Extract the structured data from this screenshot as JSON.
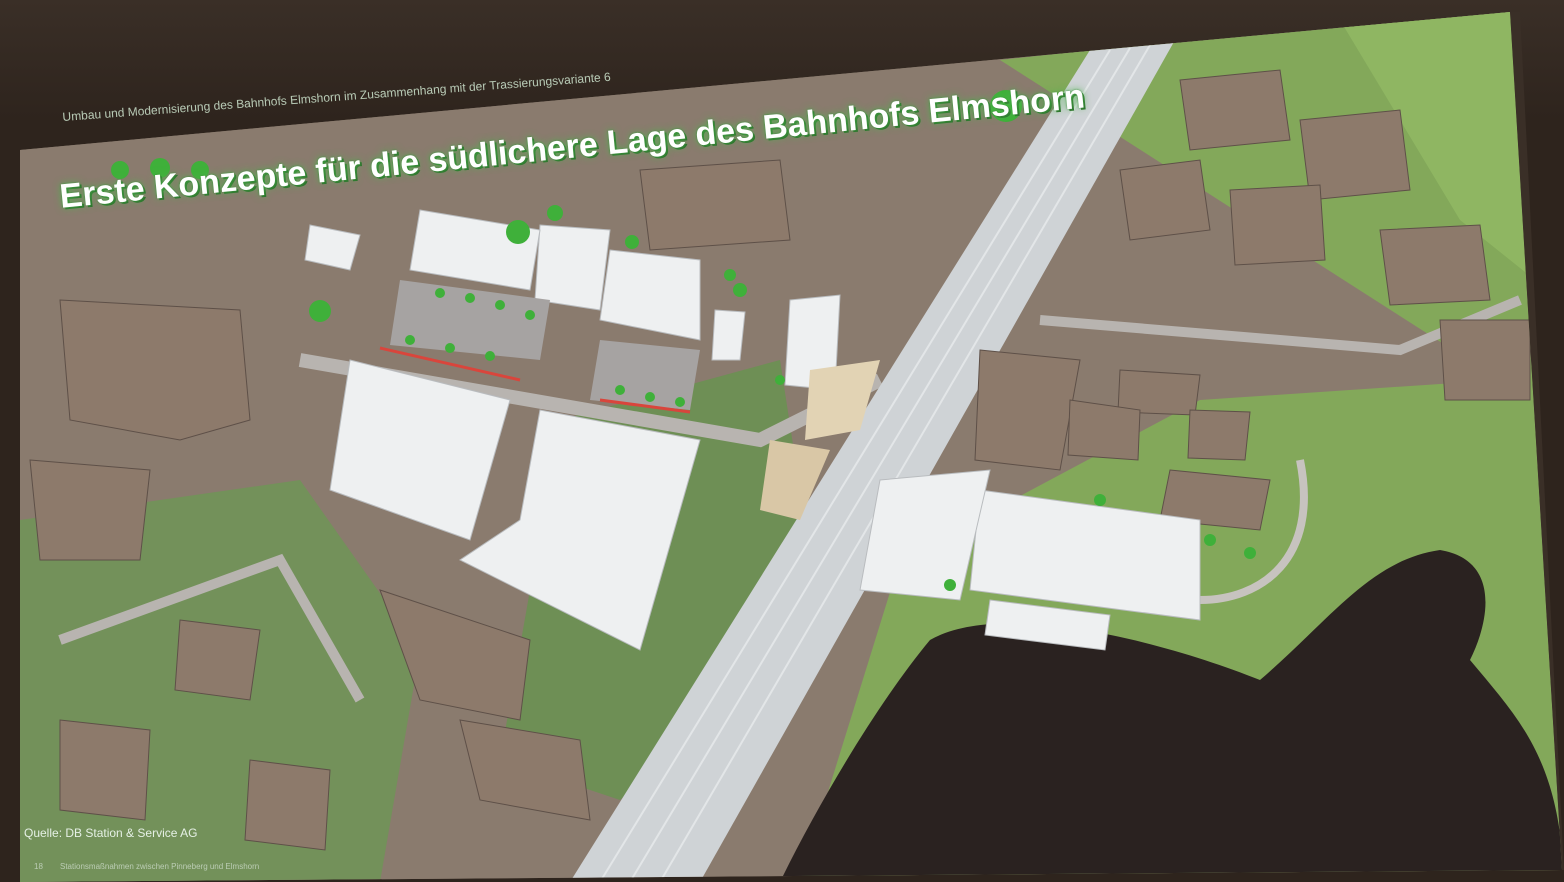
{
  "slide": {
    "subtitle": "Umbau und Modernisierung des Bahnhofs Elmshorn im Zusammenhang mit der Trassierungsvariante 6",
    "title": "Erste Konzepte für die südlichere Lage des Bahnhofs Elmshorn",
    "source_credit": "Quelle: DB Station & Service AG",
    "footer": "Stationsmaßnahmen zwischen Pinneberg und Elmshorn",
    "page_number": "18"
  },
  "colors": {
    "room_wall": "#2e241d",
    "screen_green": "#7ea35a",
    "building_white": "#eef0f1",
    "building_brown": "#8d7a6b",
    "track": "#cfd3d6",
    "pond": "#2a2220",
    "title_glow": "#4fb44f",
    "red_line": "#d9453c"
  }
}
